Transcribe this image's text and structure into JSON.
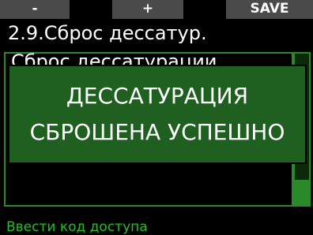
{
  "softkeys": {
    "minus": "-",
    "plus": "+",
    "save": "SAVE"
  },
  "screen": {
    "title": "2.9.Сброс дессатур.",
    "panel_title": "Сброс дессатурации"
  },
  "dialog": {
    "line1": "ДЕССАТУРАЦИЯ",
    "line2": "СБРОШЕНА УСПЕШНО"
  },
  "footer": {
    "hint": "Ввести код доступа"
  },
  "colors": {
    "accent": "#2a8a2a",
    "dialog_bg": "#1f5f1f",
    "footer_text": "#22c022"
  }
}
